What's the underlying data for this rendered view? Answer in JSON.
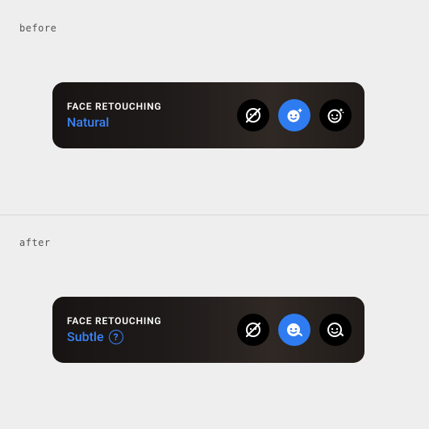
{
  "before": {
    "label": "before",
    "panel_title": "FACE RETOUCHING",
    "panel_value": "Natural",
    "options": [
      {
        "name": "off",
        "selected": false
      },
      {
        "name": "natural",
        "selected": true
      },
      {
        "name": "soft",
        "selected": false
      }
    ]
  },
  "after": {
    "label": "after",
    "panel_title": "FACE RETOUCHING",
    "panel_value": "Subtle",
    "has_help": true,
    "options": [
      {
        "name": "off",
        "selected": false
      },
      {
        "name": "subtle",
        "selected": true
      },
      {
        "name": "smooth",
        "selected": false
      }
    ]
  },
  "colors": {
    "accent": "#3b82f6",
    "selected": "#2f7cf1",
    "button_bg": "#000000"
  }
}
